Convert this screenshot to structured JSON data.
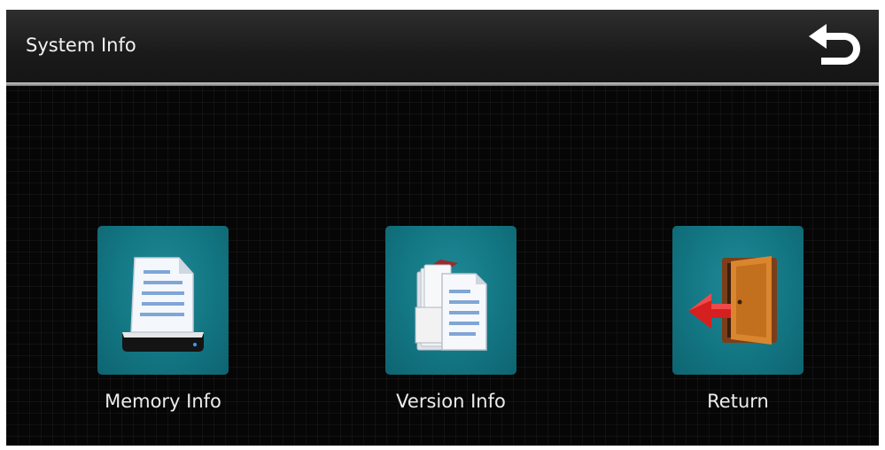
{
  "header": {
    "title": "System Info",
    "back_icon": "return-arrow-icon"
  },
  "menu": {
    "items": [
      {
        "label": "Memory Info",
        "icon": "memory-document-icon"
      },
      {
        "label": "Version Info",
        "icon": "version-files-icon"
      },
      {
        "label": "Return",
        "icon": "exit-door-icon"
      }
    ]
  },
  "colors": {
    "tile_bg": "#137683",
    "background": "#060606",
    "text": "#ececec"
  }
}
